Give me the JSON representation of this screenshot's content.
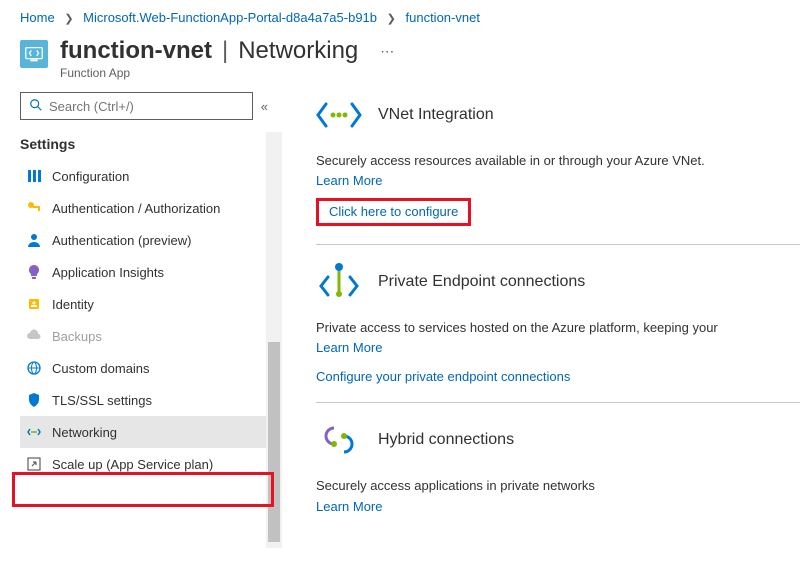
{
  "breadcrumb": {
    "home": "Home",
    "rg": "Microsoft.Web-FunctionApp-Portal-d8a4a7a5-b91b",
    "resource": "function-vnet"
  },
  "header": {
    "title": "function-vnet",
    "page": "Networking",
    "subtitle": "Function App"
  },
  "search": {
    "placeholder": "Search (Ctrl+/)"
  },
  "sidebar": {
    "section": "Settings",
    "items": [
      {
        "label": "Configuration"
      },
      {
        "label": "Authentication / Authorization"
      },
      {
        "label": "Authentication (preview)"
      },
      {
        "label": "Application Insights"
      },
      {
        "label": "Identity"
      },
      {
        "label": "Backups"
      },
      {
        "label": "Custom domains"
      },
      {
        "label": "TLS/SSL settings"
      },
      {
        "label": "Networking"
      },
      {
        "label": "Scale up (App Service plan)"
      }
    ]
  },
  "sections": {
    "vnet": {
      "title": "VNet Integration",
      "desc": "Securely access resources available in or through your Azure VNet.",
      "learn": "Learn More",
      "action": "Click here to configure"
    },
    "pe": {
      "title": "Private Endpoint connections",
      "desc": "Private access to services hosted on the Azure platform, keeping your",
      "learn": "Learn More",
      "action": "Configure your private endpoint connections"
    },
    "hybrid": {
      "title": "Hybrid connections",
      "desc": "Securely access applications in private networks",
      "learn": "Learn More"
    }
  }
}
